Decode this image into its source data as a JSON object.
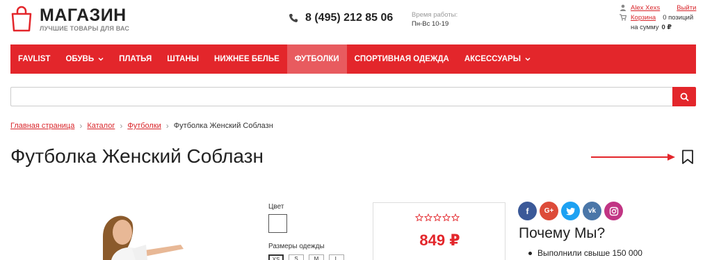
{
  "header": {
    "logo_title": "МАГАЗИН",
    "logo_subtitle": "ЛУЧШИЕ ТОВАРЫ ДЛЯ ВАС",
    "phone": "8 (495) 212 85 06",
    "hours_label": "Время работы:",
    "hours_value": "Пн-Вс 10-19",
    "user_name": "Alex Xexs",
    "logout": "Выйти",
    "cart_label": "Корзина",
    "cart_count": "0 позиций",
    "cart_sum_label": "на сумму",
    "cart_sum_value": "0 ₽"
  },
  "nav": {
    "items": [
      {
        "label": "FAVLIST",
        "dropdown": false,
        "active": false
      },
      {
        "label": "ОБУВЬ",
        "dropdown": true,
        "active": false
      },
      {
        "label": "ПЛАТЬЯ",
        "dropdown": false,
        "active": false
      },
      {
        "label": "ШТАНЫ",
        "dropdown": false,
        "active": false
      },
      {
        "label": "НИЖНЕЕ БЕЛЬЕ",
        "dropdown": false,
        "active": false
      },
      {
        "label": "ФУТБОЛКИ",
        "dropdown": false,
        "active": true
      },
      {
        "label": "СПОРТИВНАЯ ОДЕЖДА",
        "dropdown": false,
        "active": false
      },
      {
        "label": "АКСЕССУАРЫ",
        "dropdown": true,
        "active": false
      }
    ]
  },
  "search": {
    "value": "",
    "placeholder": ""
  },
  "breadcrumb": {
    "items": [
      "Главная страница",
      "Каталог",
      "Футболки"
    ],
    "current": "Футболка Женский Соблазн"
  },
  "product": {
    "title": "Футболка Женский Соблазн",
    "color_label": "Цвет",
    "size_label": "Размеры одежды",
    "sizes": [
      "XS",
      "S",
      "M",
      "L"
    ],
    "selected_size": "XS",
    "rating": 0,
    "price": "849 ₽"
  },
  "sidebar": {
    "social": [
      "facebook",
      "google-plus",
      "twitter",
      "vk",
      "instagram"
    ],
    "why_title": "Почему Мы?",
    "why_items": [
      "Выполнили свыше 150 000"
    ]
  },
  "colors": {
    "brand": "#e3262b",
    "nav_active": "#e85b5f"
  }
}
